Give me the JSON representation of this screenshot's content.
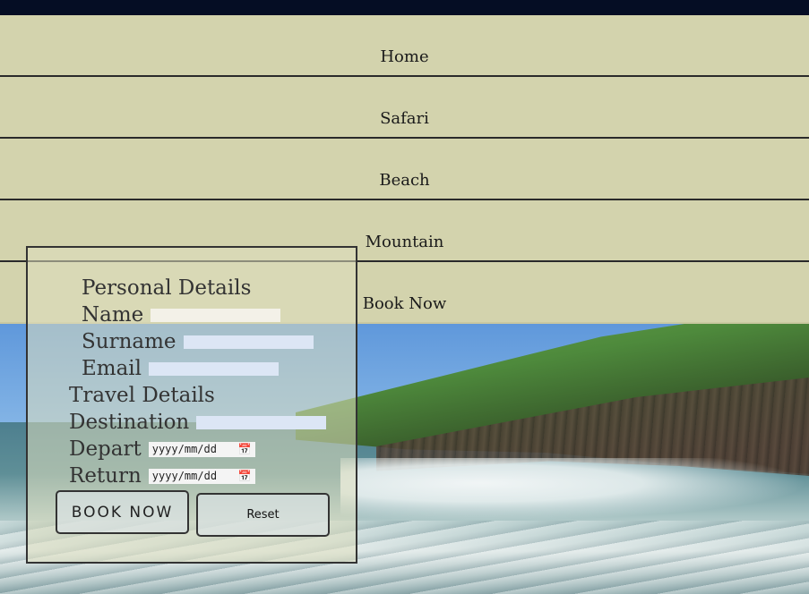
{
  "nav": {
    "items": [
      {
        "label": "Home"
      },
      {
        "label": "Safari"
      },
      {
        "label": "Beach"
      },
      {
        "label": "Mountain"
      },
      {
        "label": "Book Now"
      }
    ]
  },
  "form": {
    "personal_heading": "Personal Details",
    "name_label": "Name",
    "surname_label": "Surname",
    "email_label": "Email",
    "travel_heading": "Travel Details",
    "destination_label": "Destination",
    "depart_label": "Depart",
    "depart_placeholder": "yyyy/mm/dd",
    "return_label": "Return",
    "return_placeholder": "yyyy/mm/dd",
    "book_button": "BOOK NOW",
    "reset_button": "Reset"
  },
  "icons": {
    "calendar": "calendar-icon"
  },
  "colors": {
    "topbar": "#050d24",
    "nav_bg": "#d3d3ad",
    "panel_bg": "#deDEBE"
  }
}
